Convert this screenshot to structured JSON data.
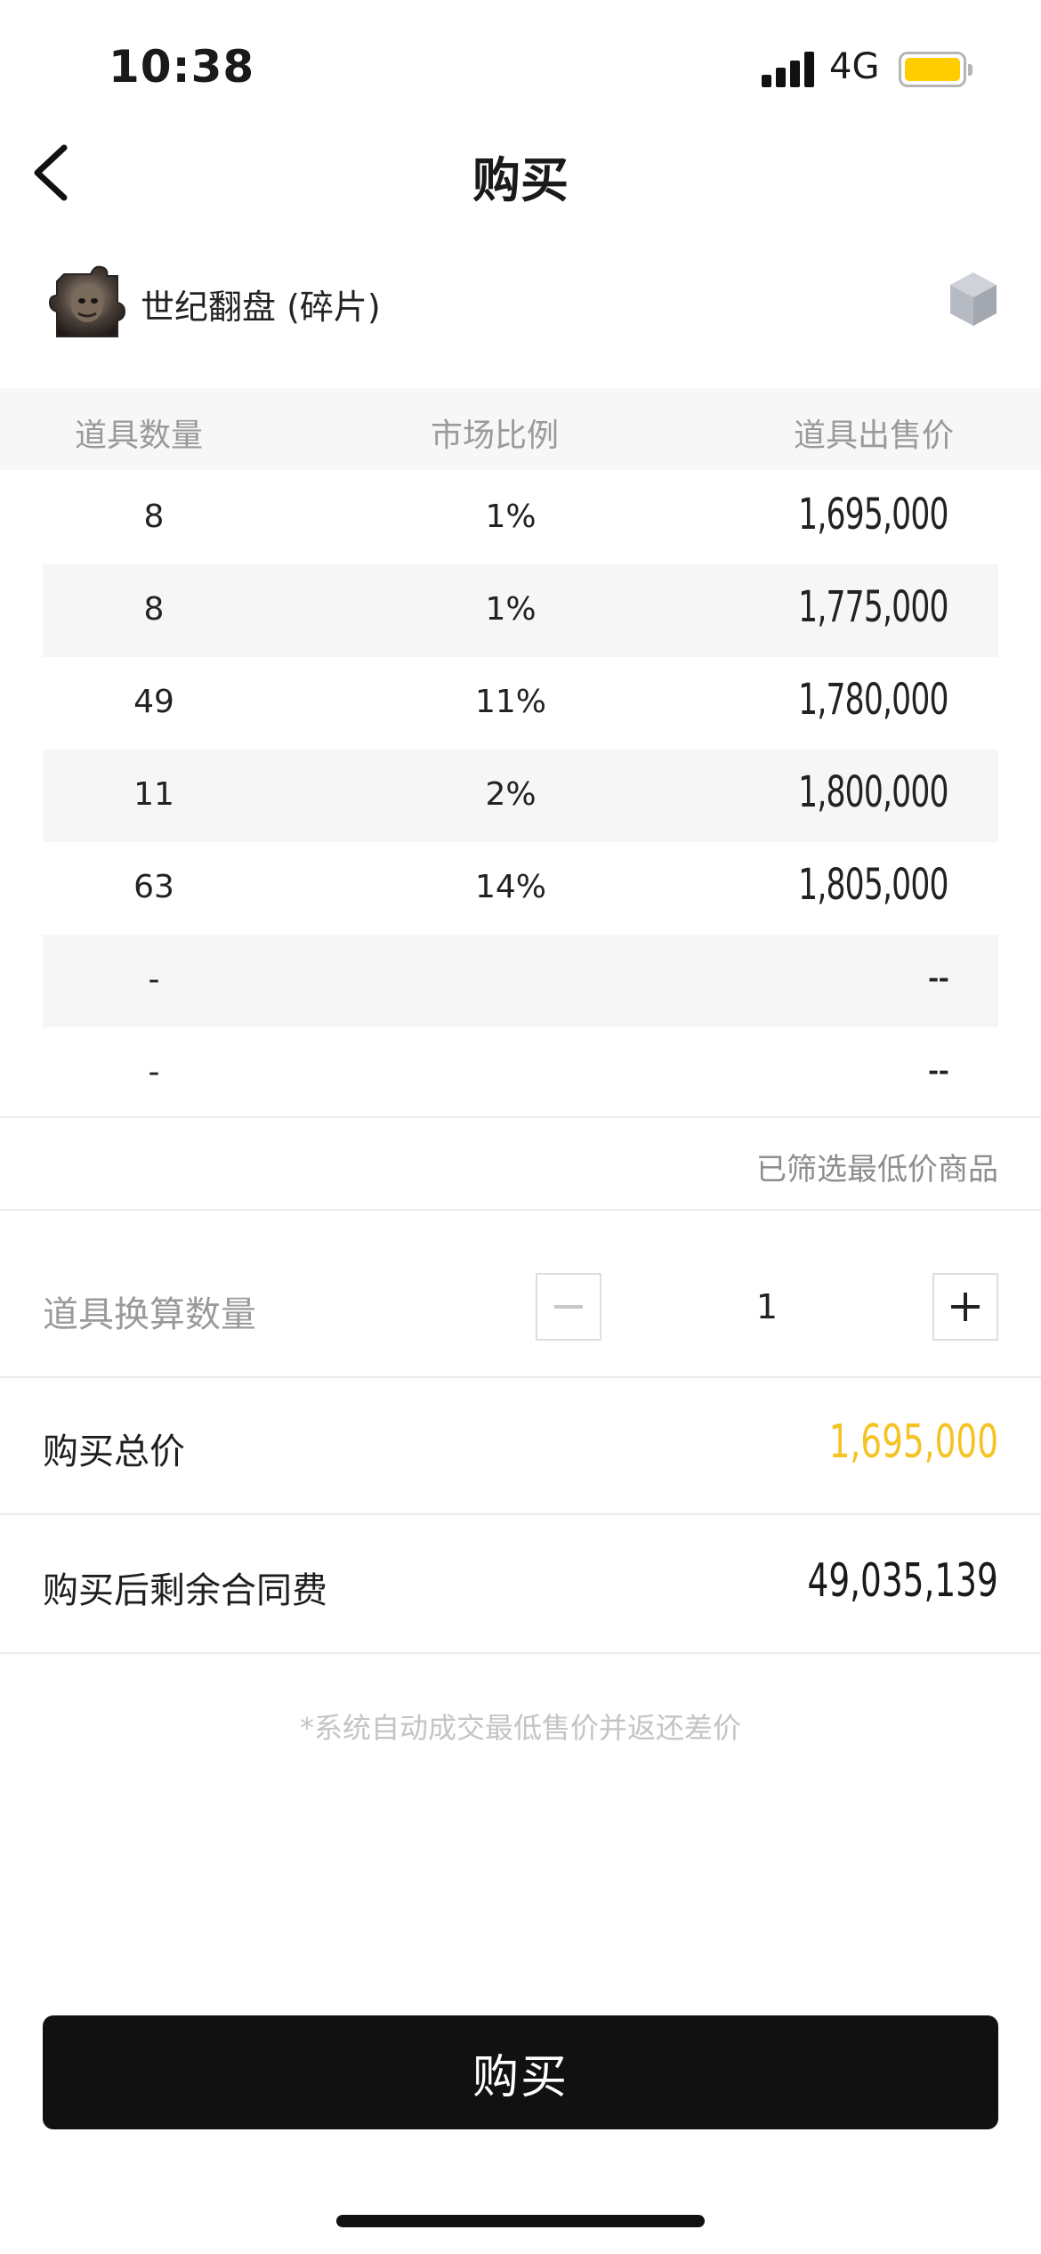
{
  "status_bar": {
    "time": "10:38",
    "network": "4G"
  },
  "colors": {
    "accent_yellow": "#f5c323",
    "battery": "#ffcc00",
    "button_dark": "#111111"
  },
  "nav": {
    "title": "购买",
    "back_icon": "chevron-left-icon"
  },
  "item": {
    "name": "世纪翻盘 (碎片)",
    "thumbnail": "item-thumbnail",
    "box_icon": "cube-icon"
  },
  "table": {
    "headers": [
      "道具数量",
      "市场比例",
      "道具出售价"
    ],
    "rows": [
      {
        "qty": "8",
        "ratio": "1%",
        "price": "1,695,000"
      },
      {
        "qty": "8",
        "ratio": "1%",
        "price": "1,775,000"
      },
      {
        "qty": "49",
        "ratio": "11%",
        "price": "1,780,000"
      },
      {
        "qty": "11",
        "ratio": "2%",
        "price": "1,800,000"
      },
      {
        "qty": "63",
        "ratio": "14%",
        "price": "1,805,000"
      },
      {
        "qty": "-",
        "ratio": "",
        "price": "--"
      },
      {
        "qty": "-",
        "ratio": "",
        "price": "--"
      }
    ]
  },
  "filter_note": "已筛选最低价商品",
  "quantity": {
    "label": "道具换算数量",
    "value": "1"
  },
  "total": {
    "label": "购买总价",
    "value": "1,695,000"
  },
  "remaining": {
    "label": "购买后剩余合同费",
    "value": "49,035,139"
  },
  "footnote": "*系统自动成交最低售价并返还差价",
  "buy_button": {
    "label": "购买"
  }
}
